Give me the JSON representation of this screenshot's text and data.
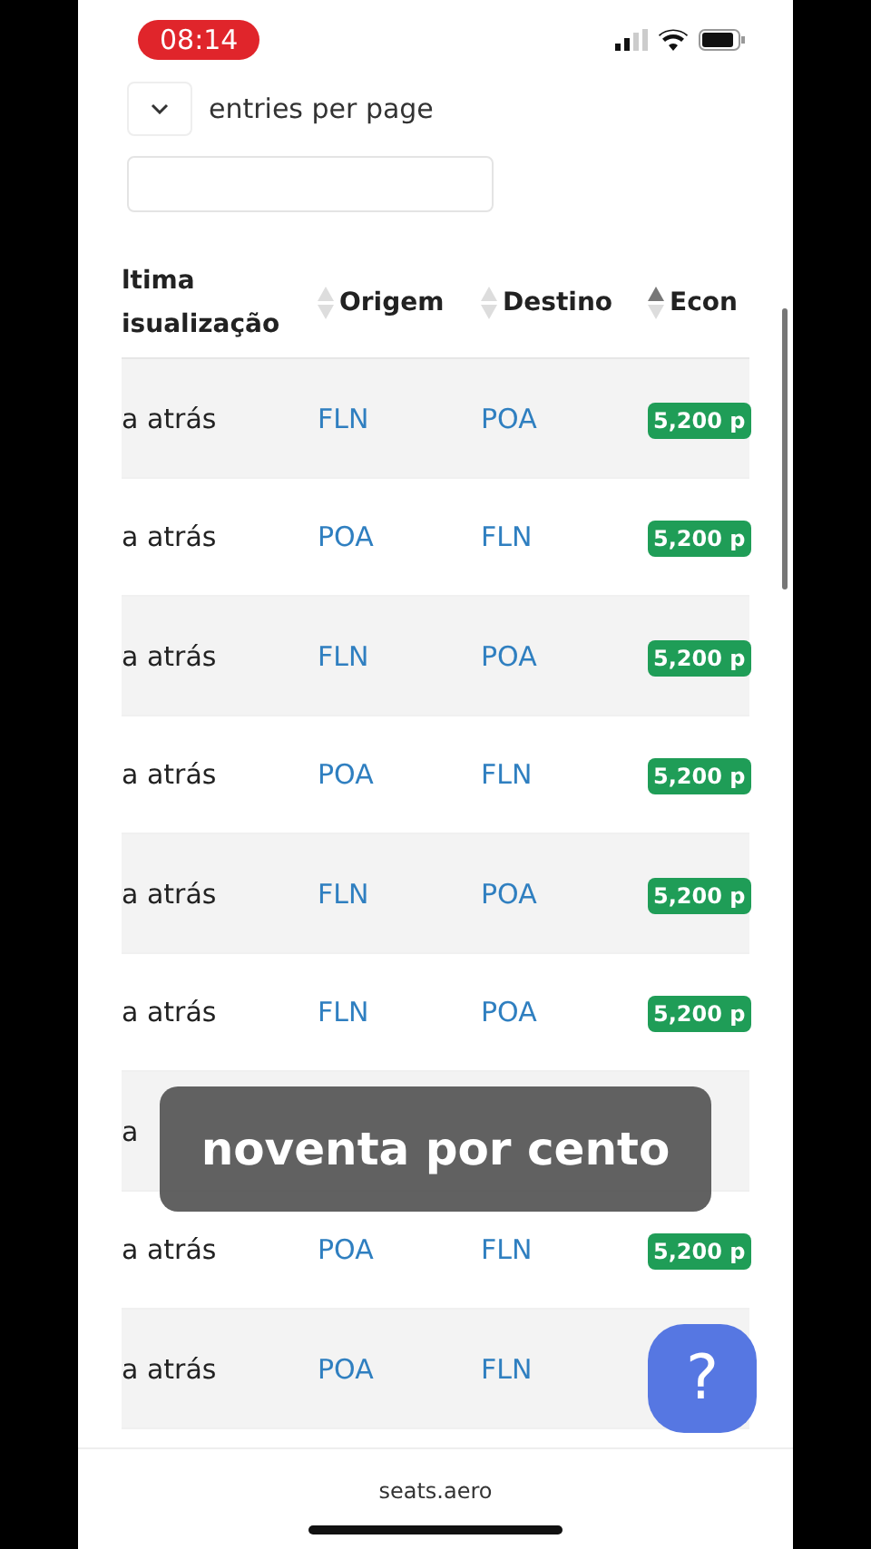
{
  "status_bar": {
    "time": "08:14"
  },
  "entries": {
    "label": "entries per page"
  },
  "table": {
    "columns": [
      {
        "label": "ltima isualização"
      },
      {
        "label": "Origem",
        "sorted": false
      },
      {
        "label": "Destino",
        "sorted": false
      },
      {
        "label": "Econ",
        "sorted": true
      }
    ],
    "rows": [
      {
        "seen": "a atrás",
        "origin": "FLN",
        "destination": "POA",
        "economy": "5,200 p"
      },
      {
        "seen": "a atrás",
        "origin": "POA",
        "destination": "FLN",
        "economy": "5,200 p"
      },
      {
        "seen": "a atrás",
        "origin": "FLN",
        "destination": "POA",
        "economy": "5,200 p"
      },
      {
        "seen": "a atrás",
        "origin": "POA",
        "destination": "FLN",
        "economy": "5,200 p"
      },
      {
        "seen": "a atrás",
        "origin": "FLN",
        "destination": "POA",
        "economy": "5,200 p"
      },
      {
        "seen": "a atrás",
        "origin": "FLN",
        "destination": "POA",
        "economy": "5,200 p"
      },
      {
        "seen": "a"
      },
      {
        "seen": "a atrás",
        "origin": "POA",
        "destination": "FLN",
        "economy": "5,200 p"
      },
      {
        "seen": "a atrás",
        "origin": "POA",
        "destination": "FLN"
      }
    ]
  },
  "caption": "noventa por cento",
  "help_button": {
    "label": "?"
  },
  "footer": {
    "site": "seats.aero"
  }
}
